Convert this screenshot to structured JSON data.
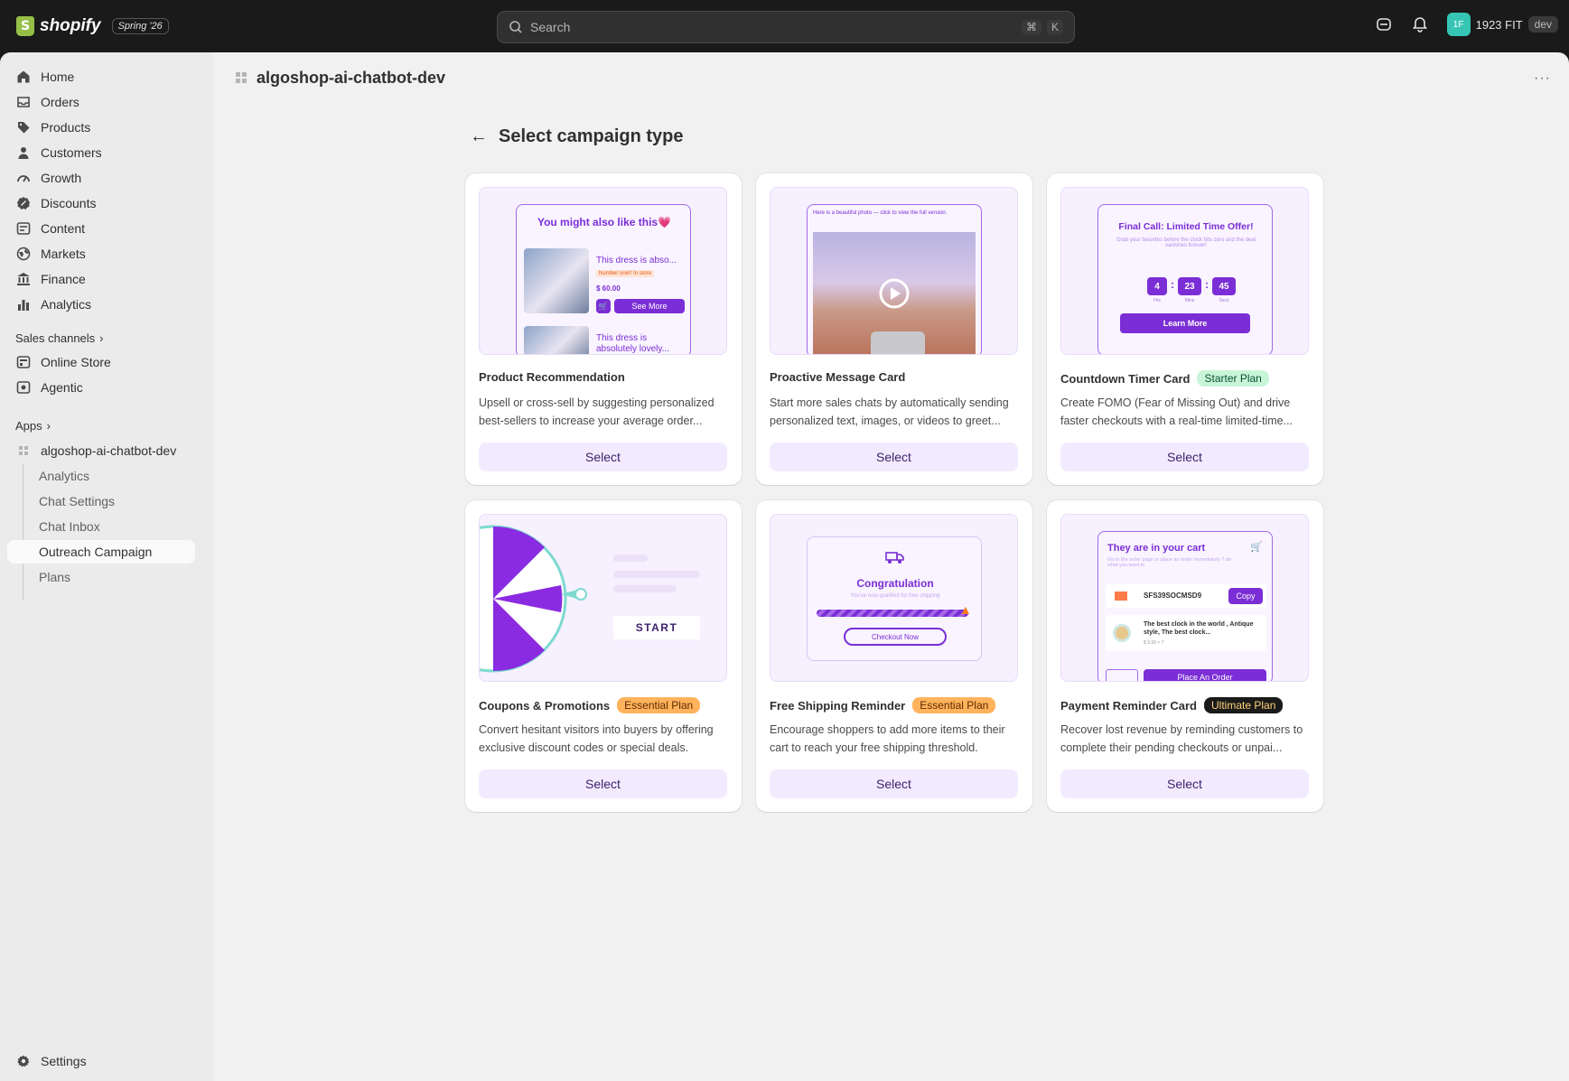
{
  "topbar": {
    "logo_text": "shopify",
    "edition": "Spring '26",
    "search_placeholder": "Search",
    "shortcut_cmd": "⌘",
    "shortcut_key": "K",
    "store_initials": "1F",
    "store_name": "1923 FIT",
    "store_tag": "dev"
  },
  "sidebar": {
    "items": [
      {
        "label": "Home",
        "icon": "home-icon"
      },
      {
        "label": "Orders",
        "icon": "inbox-icon"
      },
      {
        "label": "Products",
        "icon": "tag-icon"
      },
      {
        "label": "Customers",
        "icon": "person-icon"
      },
      {
        "label": "Growth",
        "icon": "gauge-icon"
      },
      {
        "label": "Discounts",
        "icon": "discount-icon"
      },
      {
        "label": "Content",
        "icon": "content-icon"
      },
      {
        "label": "Markets",
        "icon": "globe-icon"
      },
      {
        "label": "Finance",
        "icon": "bank-icon"
      },
      {
        "label": "Analytics",
        "icon": "bar-chart-icon"
      }
    ],
    "sales_channels_label": "Sales channels",
    "sales_channels": [
      {
        "label": "Online Store",
        "icon": "store-icon"
      },
      {
        "label": "Agentic",
        "icon": "agentic-icon"
      }
    ],
    "apps_label": "Apps",
    "app_name": "algoshop-ai-chatbot-dev",
    "app_subitems": [
      "Analytics",
      "Chat Settings",
      "Chat Inbox",
      "Outreach Campaign",
      "Plans"
    ],
    "settings_label": "Settings"
  },
  "header": {
    "app_title": "algoshop-ai-chatbot-dev",
    "page_title": "Select campaign type"
  },
  "cards": [
    {
      "title": "Product Recommendation",
      "badge": "",
      "description": "Upsell or cross-sell by suggesting personalized best-sellers to increase your average order...",
      "button": "Select",
      "preview": {
        "heading": "You might also like this💗",
        "item1": "This dress is abso...",
        "tag": "Number one!! In store",
        "price": "$ 60.00",
        "cta": "See More",
        "item2": "This dress is absolutely lovely..."
      }
    },
    {
      "title": "Proactive Message Card",
      "badge": "",
      "description": "Start more sales chats by automatically sending personalized text, images, or videos to greet...",
      "button": "Select",
      "preview": {
        "caption": "Here is a beautiful photo — click to view the full version."
      }
    },
    {
      "title": "Countdown Timer Card",
      "badge": "Starter Plan",
      "description": "Create FOMO (Fear of Missing Out) and drive faster checkouts with a real-time limited-time...",
      "button": "Select",
      "preview": {
        "heading": "Final Call: Limited Time Offer!",
        "sub": "Grab your favorites before the clock hits zero and the deal vanishes forever!",
        "hrs": "4",
        "mins": "23",
        "secs": "45",
        "hrs_label": "Hrs",
        "mins_label": "Mins",
        "secs_label": "Secs",
        "cta": "Learn More"
      }
    },
    {
      "title": "Coupons & Promotions",
      "badge": "Essential Plan",
      "description": "Convert hesitant visitors into buyers by offering exclusive discount codes or special deals.",
      "button": "Select",
      "preview": {
        "cta": "START"
      }
    },
    {
      "title": "Free Shipping Reminder",
      "badge": "Essential Plan",
      "description": "Encourage shoppers to add more items to their cart to reach your free shipping threshold.",
      "button": "Select",
      "preview": {
        "heading": "Congratulation",
        "sub": "You've now qualified for free shipping",
        "cta": "Checkout Now"
      }
    },
    {
      "title": "Payment Reminder Card",
      "badge": "Ultimate Plan",
      "description": "Recover lost revenue by reminding customers to complete their pending checkouts or unpai...",
      "button": "Select",
      "preview": {
        "heading": "They are in your cart",
        "sub": "Go to the order page or place an order immediately ? do what you want to",
        "code": "SFS39SOCMSD9",
        "copy": "Copy",
        "product": "The best clock in the world , Antique style, The best clock...",
        "price": "$ 3.99 × 7",
        "cta": "Place An Order"
      }
    }
  ]
}
